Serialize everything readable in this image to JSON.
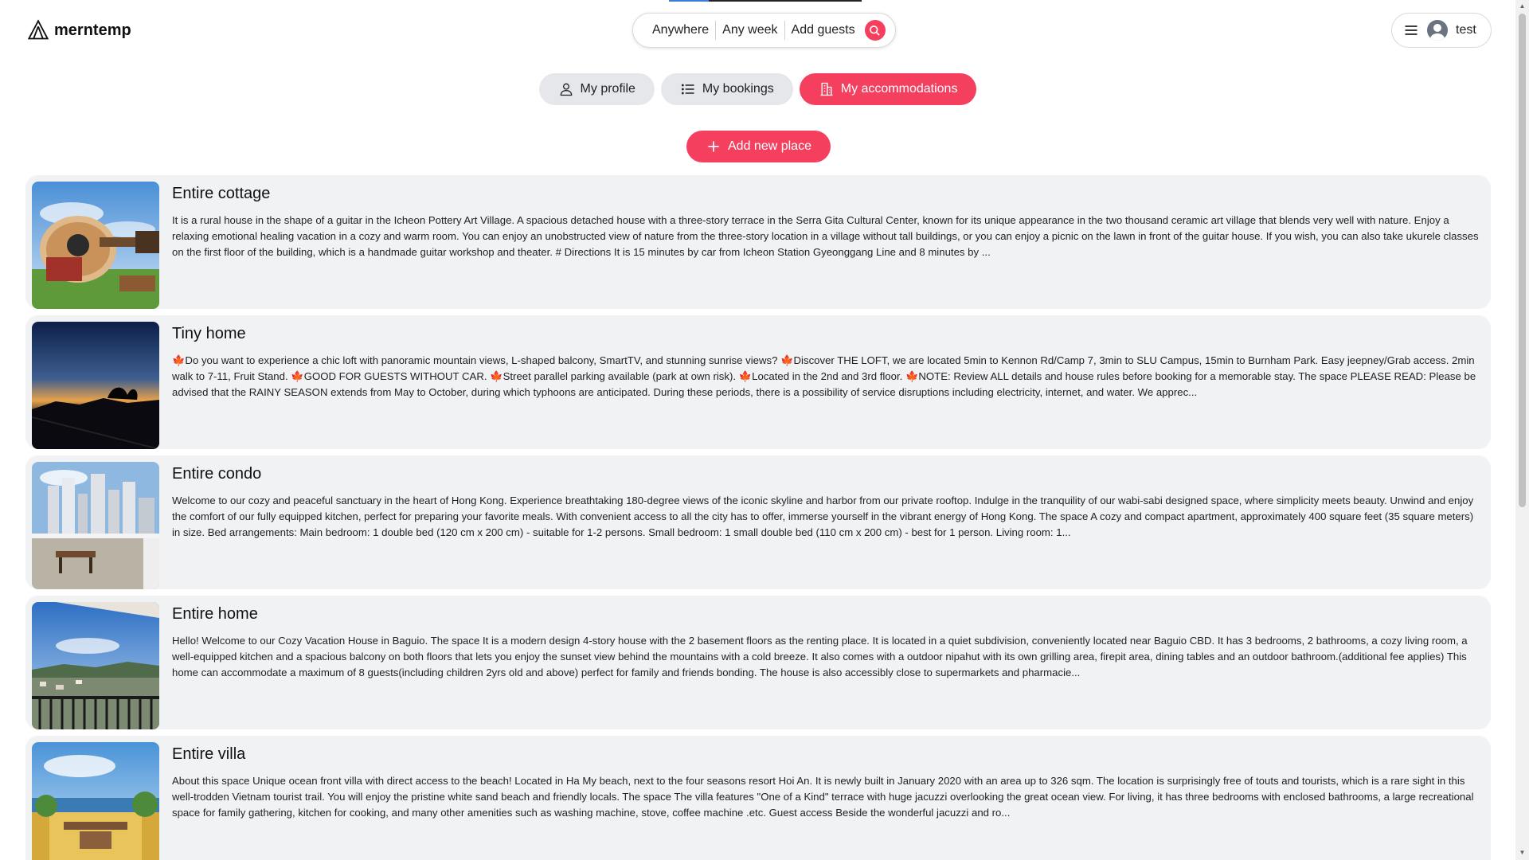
{
  "header": {
    "logo_text": "merntemp",
    "search": {
      "where": "Anywhere",
      "when": "Any week",
      "guests": "Add guests"
    },
    "user": {
      "name": "test"
    }
  },
  "tabs": [
    {
      "label": "My profile",
      "icon": "user-icon",
      "active": false
    },
    {
      "label": "My bookings",
      "icon": "list-icon",
      "active": false
    },
    {
      "label": "My accommodations",
      "icon": "building-icon",
      "active": true
    }
  ],
  "add_place_label": "Add new place",
  "places": [
    {
      "title": "Entire cottage",
      "description": "It is a rural house in the shape of a guitar in the Icheon Pottery Art Village. A spacious detached house with a three-story terrace in the Serra Gita Cultural Center, known for its unique appearance in the two thousand ceramic art village that blends very well with nature. Enjoy a relaxing emotional healing vacation in a cozy and warm room. You can enjoy an unobstructed view of nature from the three-story location in a village without tall buildings, or you can enjoy a picnic on the lawn in front of the guitar house. If you wish, you can also take ukurele classes on the first floor of the building, which is a handmade guitar workshop and theater. # Directions It is 15 minutes by car from Icheon Station Gyeonggang Line and 8 minutes by ..."
    },
    {
      "title": "Tiny home",
      "description": "🍁Do you want to experience a chic loft with panoramic mountain views, L-shaped balcony, SmartTV, and stunning sunrise views? 🍁Discover THE LOFT, we are located 5min to Kennon Rd/Camp 7, 3min to SLU Campus, 15min to Burnham Park. Easy jeepney/Grab access. 2min walk to 7-11, Fruit Stand. 🍁GOOD FOR GUESTS WITHOUT CAR. 🍁Street parallel parking available (park at own risk). 🍁Located in the 2nd and 3rd floor. 🍁NOTE: Review ALL details and house rules before booking for a memorable stay. The space PLEASE READ: Please be advised that the RAINY SEASON extends from May to October, during which typhoons are anticipated. During these periods, there is a possibility of service disruptions including electricity, internet, and water. We apprec..."
    },
    {
      "title": "Entire condo",
      "description": "Welcome to our cozy and peaceful sanctuary in the heart of Hong Kong. Experience breathtaking 180-degree views of the iconic skyline and harbor from our private rooftop. Indulge in the tranquility of our wabi-sabi designed space, where simplicity meets beauty. Unwind and enjoy the comfort of our fully equipped kitchen, perfect for preparing your favorite meals. With convenient access to all the city has to offer, immerse yourself in the vibrant energy of Hong Kong. The space A cozy and compact apartment, approximately 400 square feet (35 square meters) in size. Bed arrangements: Main bedroom: 1 double bed (120 cm x 200 cm) - suitable for 1-2 persons. Small bedroom: 1 small double bed (110 cm x 200 cm) - best for 1 person. Living room: 1..."
    },
    {
      "title": "Entire home",
      "description": "Hello! Welcome to our Cozy Vacation House in Baguio. The space It is a modern design 4-story house with the 2 basement floors as the renting place. It is located in a quiet subdivision, conveniently located near Baguio CBD. It has 3 bedrooms, 2 bathrooms, a cozy living room, a well-equipped kitchen and a spacious balcony on both floors that lets you enjoy the sunset view behind the mountains with a cold breeze. It also comes with a outdoor nipahut with its own grilling area, firepit area, dining tables and an outdoor bathroom.(additional fee applies) This home can accommodate a maximum of 8 guests(including children 2yrs old and above) perfect for family and friends bonding. The house is also accessibly close to supermarkets and pharmacie..."
    },
    {
      "title": "Entire villa",
      "description": "About this space Unique ocean front villa with direct access to the beach! Located in Ha My beach, next to the four seasons resort Hoi An. It is newly built in January 2020 with an area up to 326 sqm. The location is surprisingly free of touts and tourists, which is a rare sight in this well-trodden Vietnam tourist trail. You will enjoy the pristine white sand beach and friendly locals. The space The villa features \"One of a Kind\" terrace with huge jacuzzi overlooking the great ocean view. For living, it has three bedrooms with enclosed bathrooms, a large recreational space for family gathering, kitchen for cooking, and many other amenities such as washing machine, stove, coffee machine .etc. Guest access Beside the wonderful jacuzzi and ro..."
    }
  ],
  "colors": {
    "primary": "#f43f5e",
    "card_bg": "#f1f2f4",
    "tab_bg": "#e5e7eb"
  }
}
